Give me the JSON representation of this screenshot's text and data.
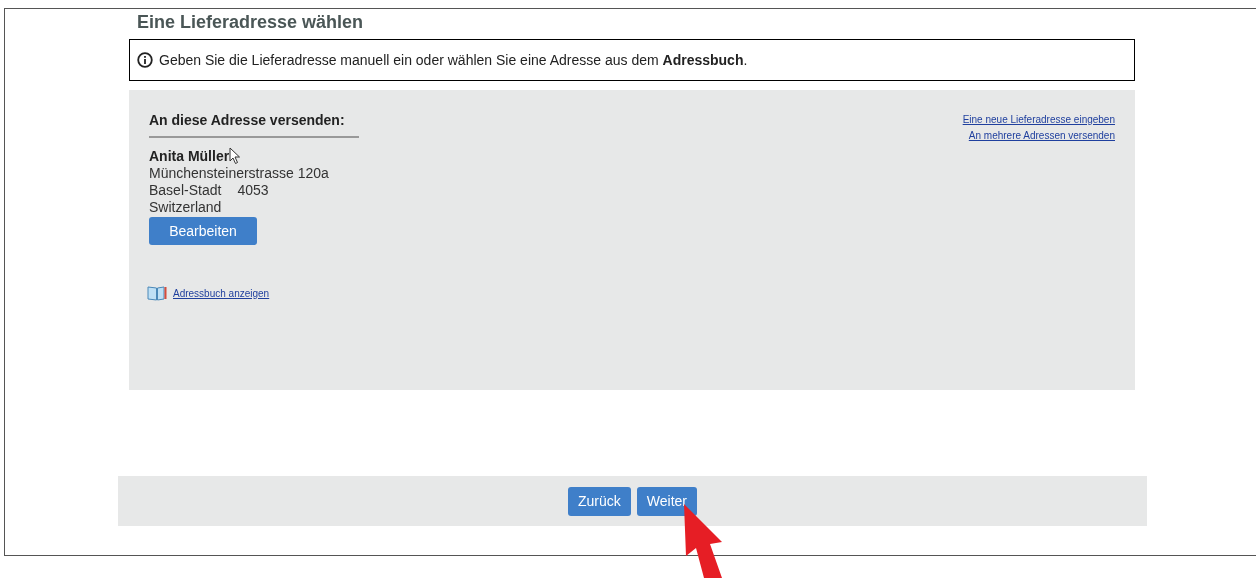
{
  "title": "Eine Lieferadresse wählen",
  "info": "Geben Sie die Lieferadresse manuell ein oder wählen Sie eine Adresse aus dem **Adressbuch**.",
  "address_section": {
    "heading": "An diese Adresse versenden:",
    "name": "Anita Müller",
    "street": "Münchensteinerstrasse 120a",
    "city": "Basel-Stadt",
    "postal_code": "4053",
    "country": "Switzerland",
    "edit_button": "Bearbeiten",
    "address_book_link": "Adressbuch anzeigen"
  },
  "side_links": [
    "Eine neue Lieferadresse eingeben",
    "An mehrere Adressen versenden"
  ],
  "footer_buttons": [
    "Zurück",
    "Weiter"
  ]
}
